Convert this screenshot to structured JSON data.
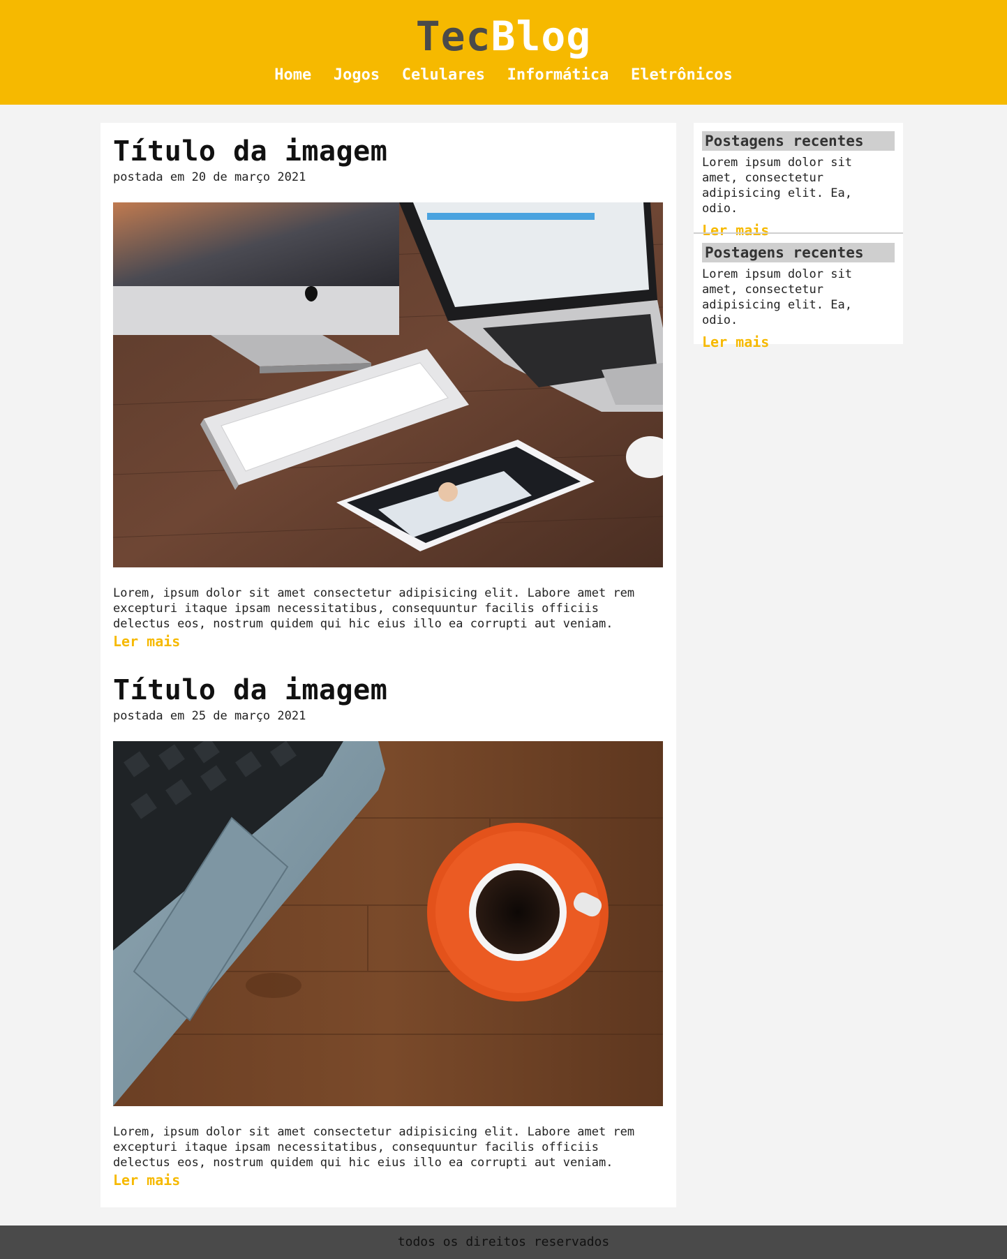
{
  "header": {
    "logo_part1": "Tec",
    "logo_part2": "Blog",
    "nav": [
      "Home",
      "Jogos",
      "Celulares",
      "Informática",
      "Eletrônicos"
    ]
  },
  "posts": [
    {
      "title": "Título da imagem",
      "date": "postada em 20 de março 2021",
      "image": "desk-apple-devices-image",
      "body": "Lorem, ipsum dolor sit amet consectetur adipisicing elit. Labore amet rem excepturi itaque ipsam necessitatibus, consequuntur facilis officiis delectus eos, nostrum quidem qui hic eius illo ea corrupti aut veniam.",
      "more": "Ler mais"
    },
    {
      "title": "Título da imagem",
      "date": "postada em 25 de março 2021",
      "image": "laptop-coffee-image",
      "body": "Lorem, ipsum dolor sit amet consectetur adipisicing elit. Labore amet rem excepturi itaque ipsam necessitatibus, consequuntur facilis officiis delectus eos, nostrum quidem qui hic eius illo ea corrupti aut veniam.",
      "more": "Ler mais"
    }
  ],
  "sidebar": [
    {
      "title": "Postagens recentes",
      "text": "Lorem ipsum dolor sit amet, consectetur adipisicing elit. Ea, odio.",
      "more": "Ler mais"
    },
    {
      "title": "Postagens recentes",
      "text": "Lorem ipsum dolor sit amet, consectetur adipisicing elit. Ea, odio.",
      "more": "Ler mais"
    }
  ],
  "footer": {
    "text": "todos os direitos reservados"
  },
  "colors": {
    "accent": "#f6b900",
    "header_bg": "#f6b900",
    "footer_bg": "#4a4a4a",
    "page_bg": "#f3f3f3",
    "widget_title_bg": "#cfcfcf"
  }
}
